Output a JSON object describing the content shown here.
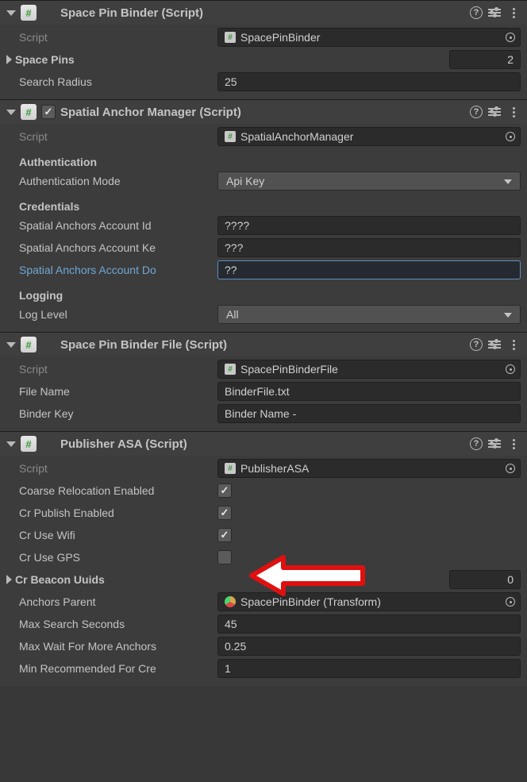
{
  "components": [
    {
      "title": "Space Pin Binder (Script)",
      "hasEnableCheckbox": false,
      "rows": [
        {
          "kind": "obj",
          "label": "Script",
          "dim": true,
          "icon": "script",
          "value": "SpacePinBinder"
        },
        {
          "kind": "numfold",
          "label": "Space Pins",
          "value": "2"
        },
        {
          "kind": "text",
          "label": "Search Radius",
          "value": "25"
        }
      ]
    },
    {
      "title": "Spatial Anchor Manager (Script)",
      "hasEnableCheckbox": true,
      "enabled": true,
      "rows": [
        {
          "kind": "obj",
          "label": "Script",
          "dim": true,
          "icon": "script",
          "value": "SpatialAnchorManager"
        },
        {
          "kind": "section",
          "label": "Authentication"
        },
        {
          "kind": "dropdown",
          "label": "Authentication Mode",
          "value": "Api Key"
        },
        {
          "kind": "section",
          "label": "Credentials"
        },
        {
          "kind": "text",
          "label": "Spatial Anchors Account Id",
          "value": "????"
        },
        {
          "kind": "text",
          "label": "Spatial Anchors Account Ke",
          "value": "???"
        },
        {
          "kind": "text",
          "label": "Spatial Anchors Account Do",
          "value": "??",
          "link": true,
          "focused": true
        },
        {
          "kind": "section",
          "label": "Logging"
        },
        {
          "kind": "dropdown",
          "label": "Log Level",
          "value": "All"
        }
      ]
    },
    {
      "title": "Space Pin Binder File (Script)",
      "hasEnableCheckbox": false,
      "rows": [
        {
          "kind": "obj",
          "label": "Script",
          "dim": true,
          "icon": "script",
          "value": "SpacePinBinderFile"
        },
        {
          "kind": "text",
          "label": "File Name",
          "value": "BinderFile.txt"
        },
        {
          "kind": "text",
          "label": "Binder Key",
          "value": "Binder Name -"
        }
      ]
    },
    {
      "title": "Publisher ASA (Script)",
      "hasEnableCheckbox": false,
      "rows": [
        {
          "kind": "obj",
          "label": "Script",
          "dim": true,
          "icon": "script",
          "value": "PublisherASA"
        },
        {
          "kind": "check",
          "label": "Coarse Relocation Enabled",
          "checked": true
        },
        {
          "kind": "check",
          "label": "Cr Publish Enabled",
          "checked": true
        },
        {
          "kind": "check",
          "label": "Cr Use Wifi",
          "checked": true
        },
        {
          "kind": "check",
          "label": "Cr Use GPS",
          "checked": false
        },
        {
          "kind": "numfold",
          "label": "Cr Beacon Uuids",
          "value": "0"
        },
        {
          "kind": "obj",
          "label": "Anchors Parent",
          "icon": "transform",
          "value": "SpacePinBinder (Transform)"
        },
        {
          "kind": "text",
          "label": "Max Search Seconds",
          "value": "45"
        },
        {
          "kind": "text",
          "label": "Max Wait For More Anchors",
          "value": "0.25"
        },
        {
          "kind": "text",
          "label": "Min Recommended For Cre",
          "value": "1"
        }
      ]
    }
  ]
}
